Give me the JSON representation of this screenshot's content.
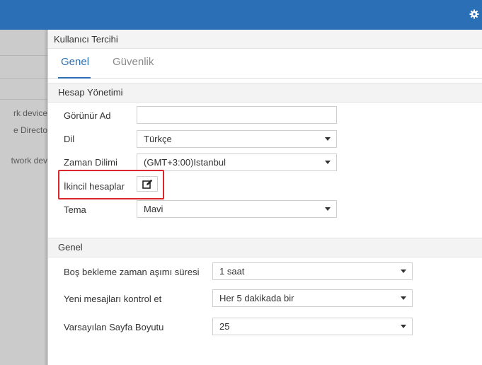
{
  "topbar": {
    "bg_color": "#2b6fb6",
    "icon": "gear-icon"
  },
  "sidebar": {
    "items": [
      {
        "label": "rk device"
      },
      {
        "label": "e Directo"
      },
      {
        "label": "twork dev"
      }
    ]
  },
  "panel": {
    "title": "Kullanıcı Tercihi",
    "tabs": [
      {
        "label": "Genel",
        "active": true
      },
      {
        "label": "Güvenlik",
        "active": false
      }
    ]
  },
  "account_section": {
    "header": "Hesap Yönetimi",
    "display_name_label": "Görünür Ad",
    "display_name_value": "",
    "language_label": "Dil",
    "language_value": "Türkçe",
    "timezone_label": "Zaman Dilimi",
    "timezone_value": "(GMT+3:00)Istanbul",
    "secondary_accounts_label": "İkincil hesaplar",
    "secondary_accounts_icon": "edit-icon",
    "theme_label": "Tema",
    "theme_value": "Mavi"
  },
  "general_section": {
    "header": "Genel",
    "idle_timeout_label": "Boş bekleme zaman aşımı süresi",
    "idle_timeout_value": "1 saat",
    "check_messages_label": "Yeni mesajları kontrol et",
    "check_messages_value": "Her 5 dakikada bir",
    "page_size_label": "Varsayılan Sayfa Boyutu",
    "page_size_value": "25"
  },
  "highlight_color": "#d9262a"
}
